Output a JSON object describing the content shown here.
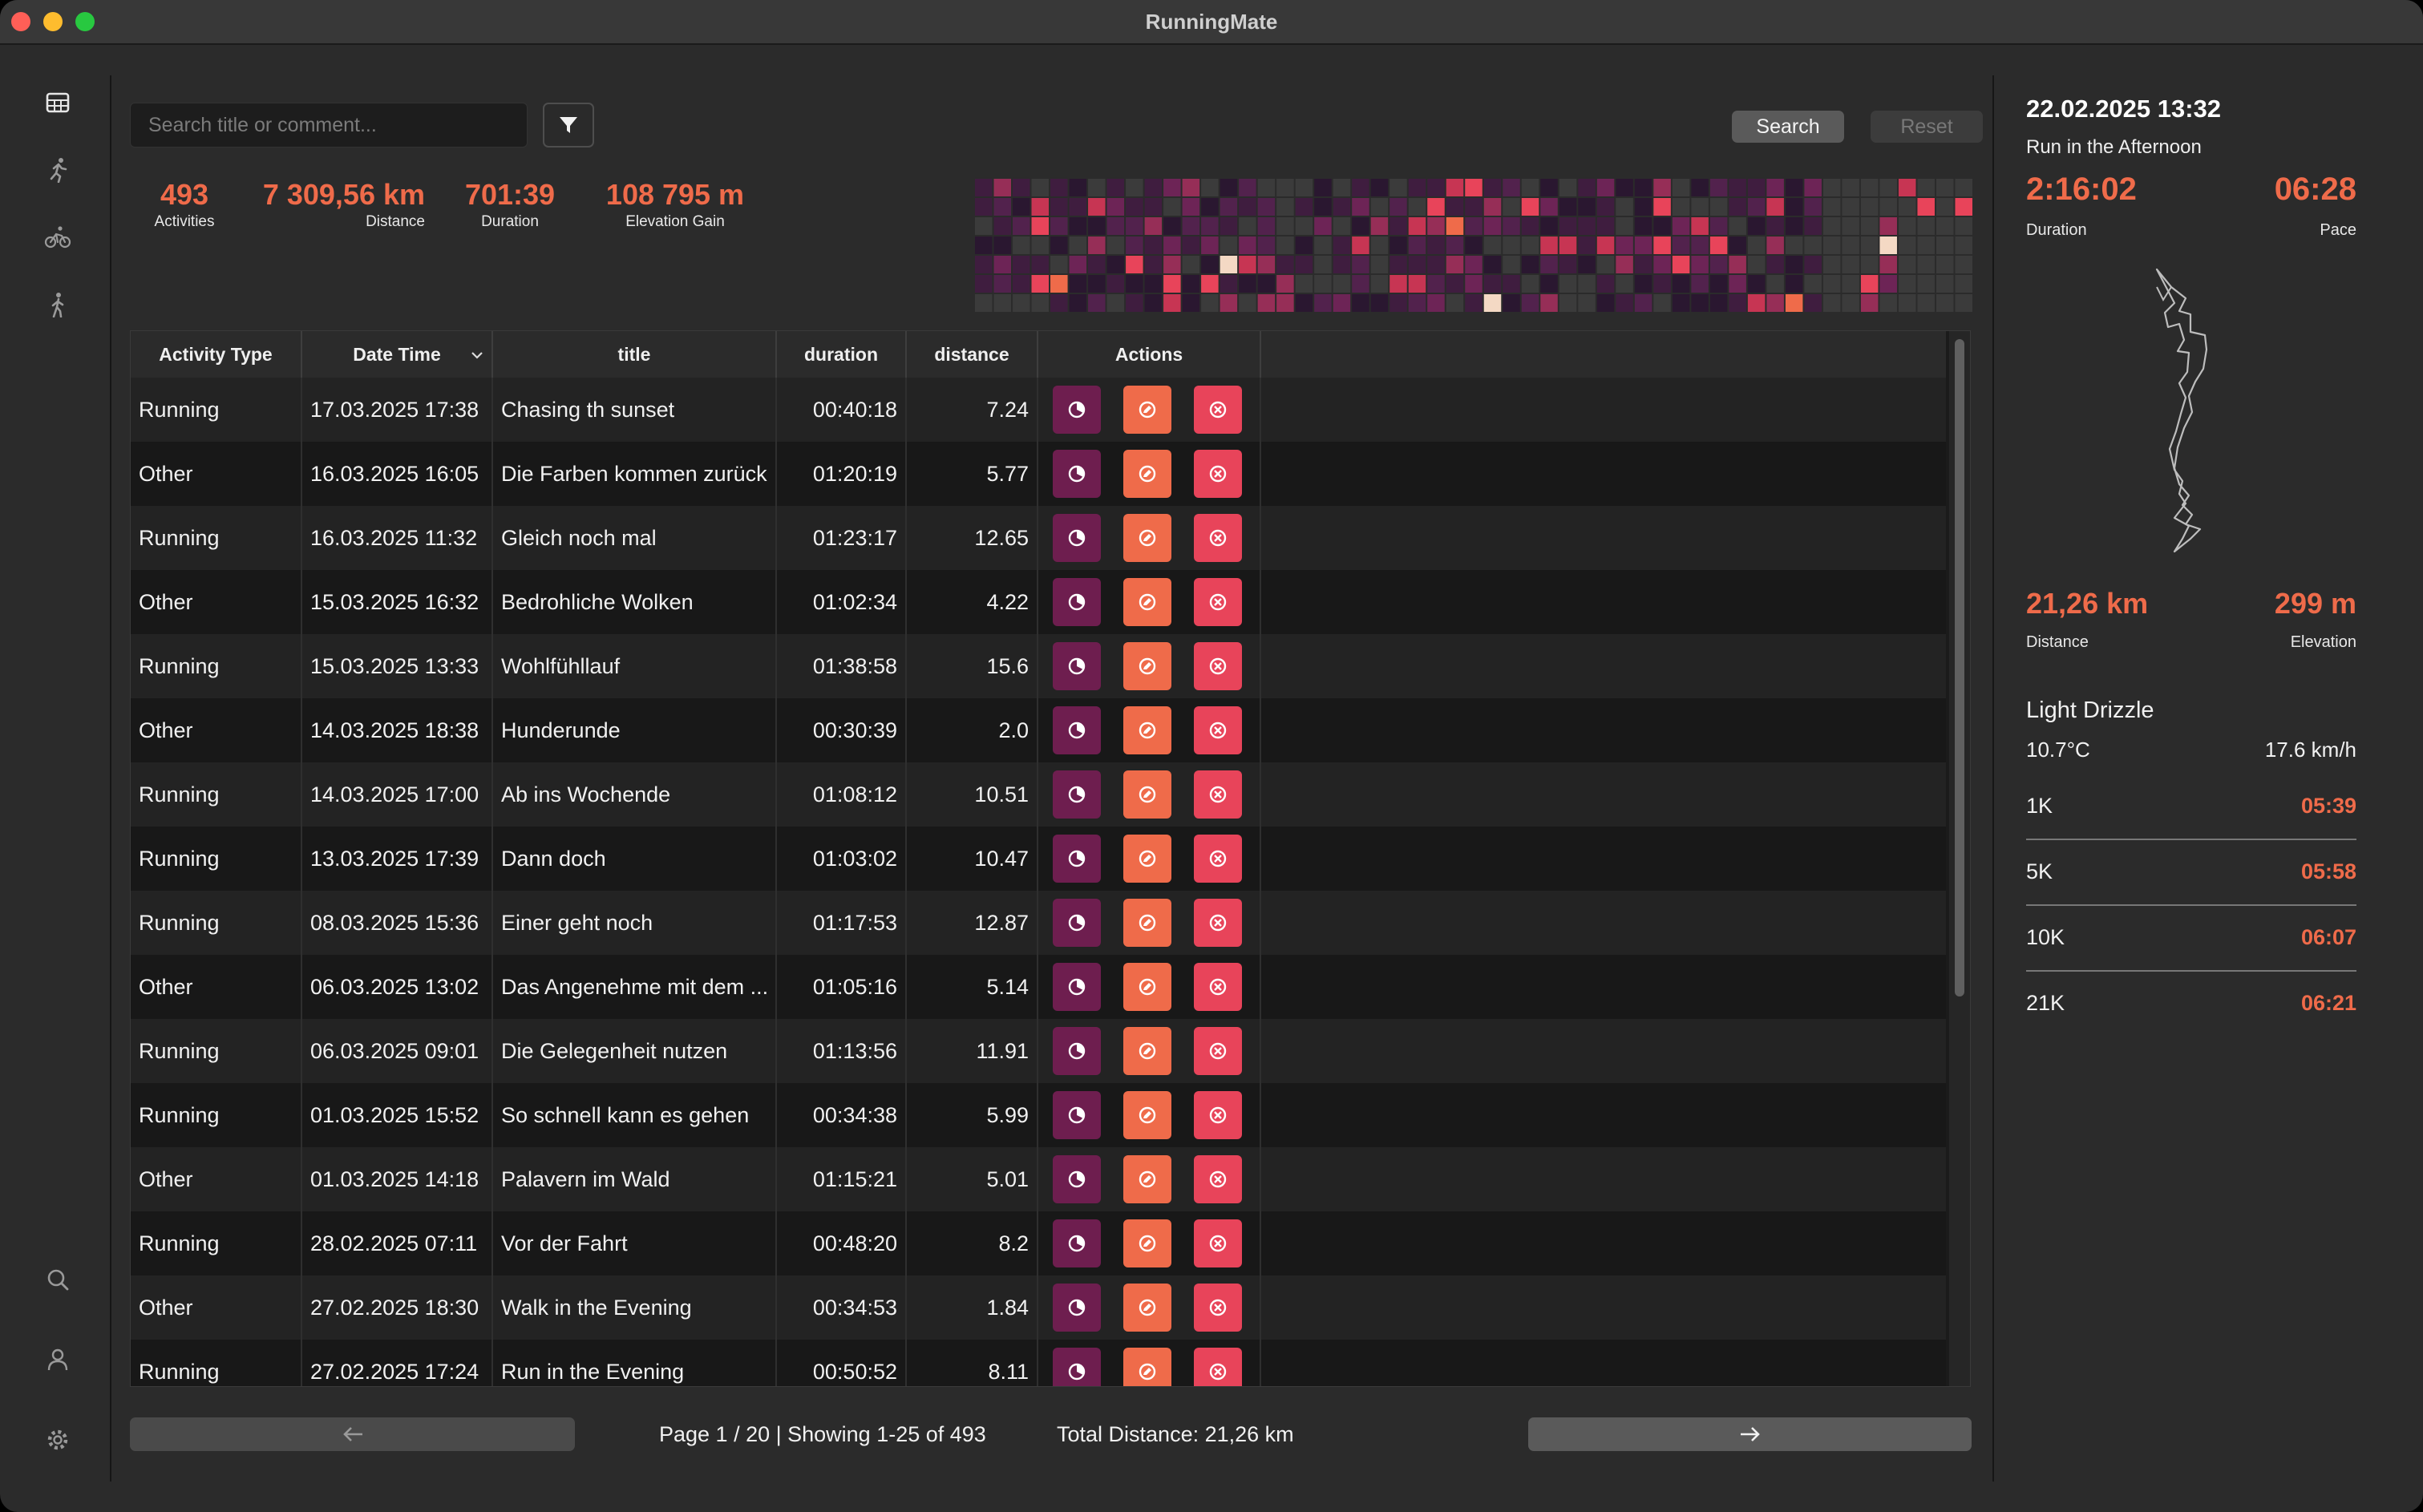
{
  "app": {
    "title": "RunningMate"
  },
  "toolbar": {
    "search_placeholder": "Search title or comment...",
    "search_label": "Search",
    "reset_label": "Reset"
  },
  "stats": [
    {
      "value": "493",
      "label": "Activities"
    },
    {
      "value": "7 309,56 km",
      "label": "Distance"
    },
    {
      "value": "701:39",
      "label": "Duration"
    },
    {
      "value": "108 795 m",
      "label": "Elevation Gain"
    }
  ],
  "heatmap": {
    "columns": 53,
    "rows": 7,
    "colors": [
      "#3b3b3b",
      "#2a1730",
      "#3f1d3f",
      "#52224d",
      "#6d2456",
      "#962e57",
      "#c73553",
      "#e8445a",
      "#f4d9c4",
      "#ef6b4a"
    ]
  },
  "table": {
    "columns": {
      "activity_type": "Activity Type",
      "date_time": "Date Time",
      "title": "title",
      "duration": "duration",
      "distance": "distance",
      "actions": "Actions"
    },
    "rows": [
      {
        "type": "Running",
        "date": "17.03.2025 17:38",
        "title": "Chasing th sunset",
        "duration": "00:40:18",
        "distance": "7.24"
      },
      {
        "type": "Other",
        "date": "16.03.2025 16:05",
        "title": "Die Farben kommen zurück",
        "duration": "01:20:19",
        "distance": "5.77"
      },
      {
        "type": "Running",
        "date": "16.03.2025 11:32",
        "title": "Gleich noch mal",
        "duration": "01:23:17",
        "distance": "12.65"
      },
      {
        "type": "Other",
        "date": "15.03.2025 16:32",
        "title": "Bedrohliche Wolken",
        "duration": "01:02:34",
        "distance": "4.22"
      },
      {
        "type": "Running",
        "date": "15.03.2025 13:33",
        "title": "Wohlfühllauf",
        "duration": "01:38:58",
        "distance": "15.6"
      },
      {
        "type": "Other",
        "date": "14.03.2025 18:38",
        "title": "Hunderunde",
        "duration": "00:30:39",
        "distance": "2.0"
      },
      {
        "type": "Running",
        "date": "14.03.2025 17:00",
        "title": "Ab ins Wochende",
        "duration": "01:08:12",
        "distance": "10.51"
      },
      {
        "type": "Running",
        "date": "13.03.2025 17:39",
        "title": "Dann doch",
        "duration": "01:03:02",
        "distance": "10.47"
      },
      {
        "type": "Running",
        "date": "08.03.2025 15:36",
        "title": "Einer geht noch",
        "duration": "01:17:53",
        "distance": "12.87"
      },
      {
        "type": "Other",
        "date": "06.03.2025 13:02",
        "title": "Das Angenehme mit dem ...",
        "duration": "01:05:16",
        "distance": "5.14"
      },
      {
        "type": "Running",
        "date": "06.03.2025 09:01",
        "title": "Die Gelegenheit nutzen",
        "duration": "01:13:56",
        "distance": "11.91"
      },
      {
        "type": "Running",
        "date": "01.03.2025 15:52",
        "title": "So schnell kann es gehen",
        "duration": "00:34:38",
        "distance": "5.99"
      },
      {
        "type": "Other",
        "date": "01.03.2025 14:18",
        "title": "Palavern im Wald",
        "duration": "01:15:21",
        "distance": "5.01"
      },
      {
        "type": "Running",
        "date": "28.02.2025 07:11",
        "title": "Vor der Fahrt",
        "duration": "00:48:20",
        "distance": "8.2"
      },
      {
        "type": "Other",
        "date": "27.02.2025 18:30",
        "title": "Walk in the Evening",
        "duration": "00:34:53",
        "distance": "1.84"
      },
      {
        "type": "Running",
        "date": "27.02.2025 17:24",
        "title": "Run in the Evening",
        "duration": "00:50:52",
        "distance": "8.11"
      }
    ]
  },
  "footer": {
    "page_info": "Page 1 / 20 | Showing 1-25 of 493",
    "total_distance": "Total Distance: 21,26 km"
  },
  "detail": {
    "datetime": "22.02.2025 13:32",
    "name": "Run in the Afternoon",
    "duration": "2:16:02",
    "duration_label": "Duration",
    "pace": "06:28",
    "pace_label": "Pace",
    "distance": "21,26 km",
    "distance_label": "Distance",
    "elevation": "299 m",
    "elevation_label": "Elevation",
    "weather": "Light Drizzle",
    "temperature": "10.7°C",
    "wind": "17.6 km/h",
    "splits": [
      {
        "label": "1K",
        "time": "05:39"
      },
      {
        "label": "5K",
        "time": "05:58"
      },
      {
        "label": "10K",
        "time": "06:07"
      },
      {
        "label": "21K",
        "time": "06:21"
      }
    ]
  },
  "colors": {
    "accent": "#ef6b4a",
    "view_button": "#6e1e4f",
    "edit_button": "#ef6b4a",
    "delete_button": "#e8445a"
  }
}
